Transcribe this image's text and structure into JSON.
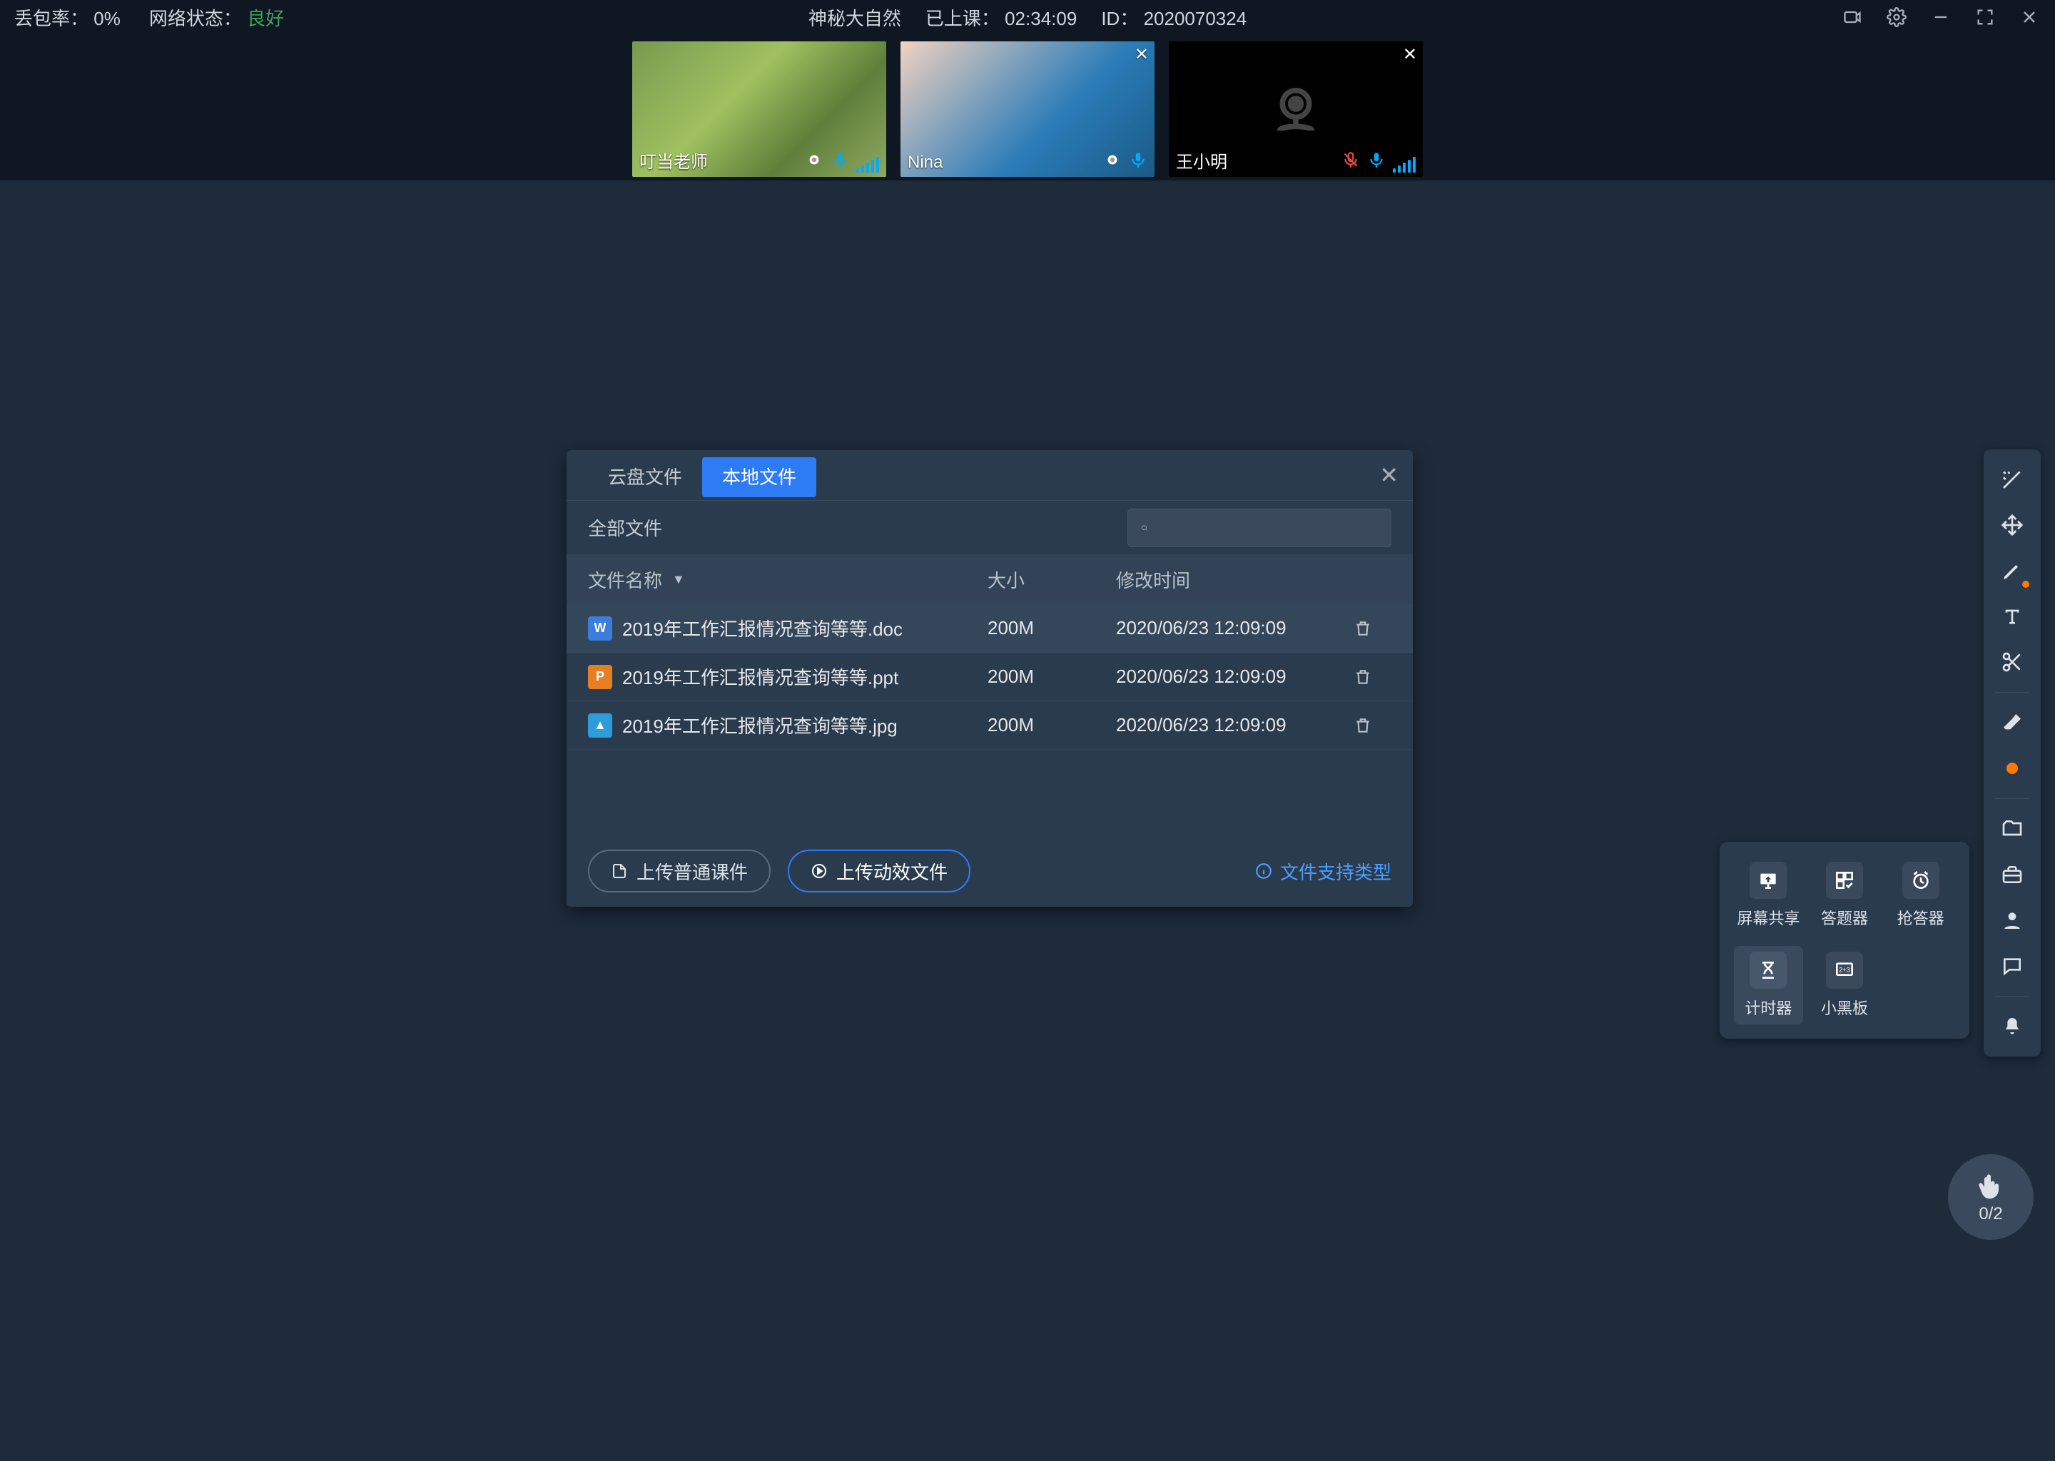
{
  "topbar": {
    "packet_loss_label": "丢包率：",
    "packet_loss_value": "0%",
    "net_label": "网络状态：",
    "net_value": "良好",
    "title": "神秘大自然",
    "elapsed_label": "已上课：",
    "elapsed_value": "02:34:09",
    "id_label": "ID：",
    "id_value": "2020070324"
  },
  "participants": [
    {
      "name": "叮当老师",
      "camera_off": false,
      "closeable": false,
      "mic_muted": false
    },
    {
      "name": "Nina",
      "camera_off": false,
      "closeable": true,
      "mic_muted": false
    },
    {
      "name": "王小明",
      "camera_off": true,
      "closeable": true,
      "mic_muted": true
    }
  ],
  "file_dialog": {
    "tab_cloud": "云盘文件",
    "tab_local": "本地文件",
    "breadcrumb": "全部文件",
    "search_placeholder": "",
    "columns": {
      "name": "文件名称",
      "size": "大小",
      "mtime": "修改时间"
    },
    "rows": [
      {
        "type": "doc",
        "glyph": "W",
        "name": "2019年工作汇报情况查询等等.doc",
        "size": "200M",
        "mtime": "2020/06/23 12:09:09"
      },
      {
        "type": "ppt",
        "glyph": "P",
        "name": "2019年工作汇报情况查询等等.ppt",
        "size": "200M",
        "mtime": "2020/06/23 12:09:09"
      },
      {
        "type": "img",
        "glyph": "▲",
        "name": "2019年工作汇报情况查询等等.jpg",
        "size": "200M",
        "mtime": "2020/06/23 12:09:09"
      }
    ],
    "btn_upload_normal": "上传普通课件",
    "btn_upload_anim": "上传动效文件",
    "hint": "文件支持类型"
  },
  "popout": {
    "screen_share": "屏幕共享",
    "answer": "答题器",
    "buzzer": "抢答器",
    "timer": "计时器",
    "blackboard": "小黑板"
  },
  "hand": {
    "count": "0/2"
  }
}
